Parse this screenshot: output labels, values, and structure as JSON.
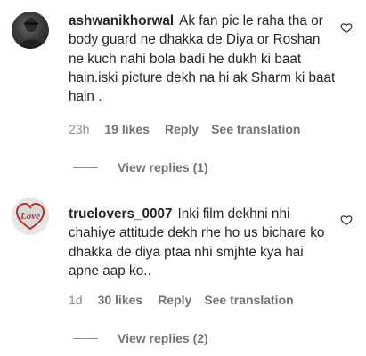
{
  "comments": [
    {
      "username": "ashwanikhorwal",
      "text": "Ak fan pic le raha tha or body guard ne dhakka de Diya or Roshan ne kuch nahi bola badi he dukh ki baat hain.iski picture dekh na hi ak Sharm ki baat hain .",
      "time": "23h",
      "likes": "19 likes",
      "reply": "Reply",
      "translation": "See translation",
      "view_replies": "View replies (1)",
      "avatar_icon": "profile-photo-icon"
    },
    {
      "username": "truelovers_0007",
      "text": "Inki film dekhni nhi chahiye attitude dekh rhe ho us bichare ko dhakka de diya ptaa nhi smjhte kya hai apne aap ko..",
      "time": "1d",
      "likes": "30 likes",
      "reply": "Reply",
      "translation": "See translation",
      "view_replies": "View replies (2)",
      "avatar_icon": "love-heart-icon",
      "avatar_text": "Love"
    }
  ],
  "icons": {
    "like": "heart-outline-icon"
  },
  "colors": {
    "text": "#262626",
    "secondary": "#8e8e8e"
  }
}
